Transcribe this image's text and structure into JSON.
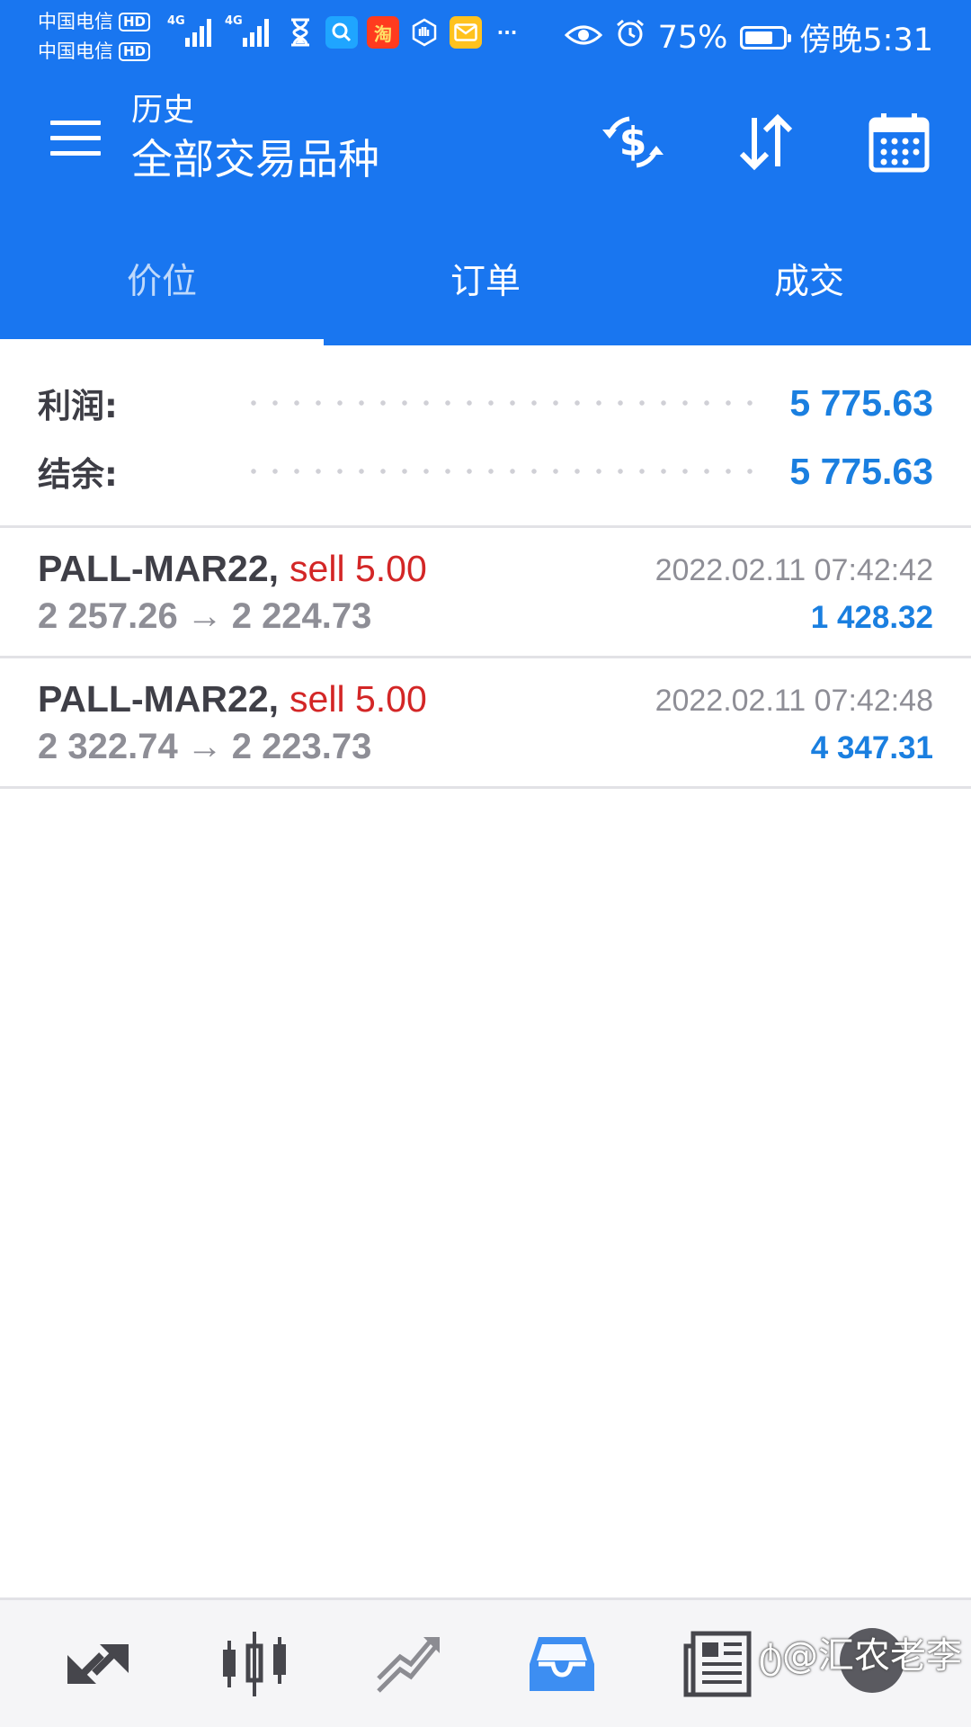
{
  "status_bar": {
    "carrier1": "中国电信",
    "carrier2": "中国电信",
    "hd_badge": "HD",
    "net1": "4G",
    "net2": "4G",
    "taobao_glyph": "淘",
    "battery_percent": "75%",
    "battery_level": 0.75,
    "time": "傍晚5:31",
    "more": "···"
  },
  "app_bar": {
    "subtitle": "历史",
    "title": "全部交易品种"
  },
  "tabs": [
    {
      "label": "价位",
      "active": true
    },
    {
      "label": "订单",
      "active": false
    },
    {
      "label": "成交",
      "active": false
    }
  ],
  "summary": {
    "profit_label": "利润:",
    "profit_value": "5 775.63",
    "balance_label": "结余:",
    "balance_value": "5 775.63"
  },
  "deals": [
    {
      "symbol": "PALL-MAR22",
      "separator": ",",
      "type": "sell 5.00",
      "open_price": "2 257.26",
      "arrow": "→",
      "close_price": "2 224.73",
      "time": "2022.02.11 07:42:42",
      "profit": "1 428.32"
    },
    {
      "symbol": "PALL-MAR22",
      "separator": ",",
      "type": "sell 5.00",
      "open_price": "2 322.74",
      "arrow": "→",
      "close_price": "2 223.73",
      "time": "2022.02.11 07:42:48",
      "profit": "4 347.31"
    }
  ],
  "watermark": "ტ@汇农老李",
  "colors": {
    "primary": "#1976f0",
    "profit_blue": "#1a7fe0",
    "sell_red": "#d32626",
    "nav_active": "#3d8ef2",
    "nav_inactive": "#46464c"
  }
}
